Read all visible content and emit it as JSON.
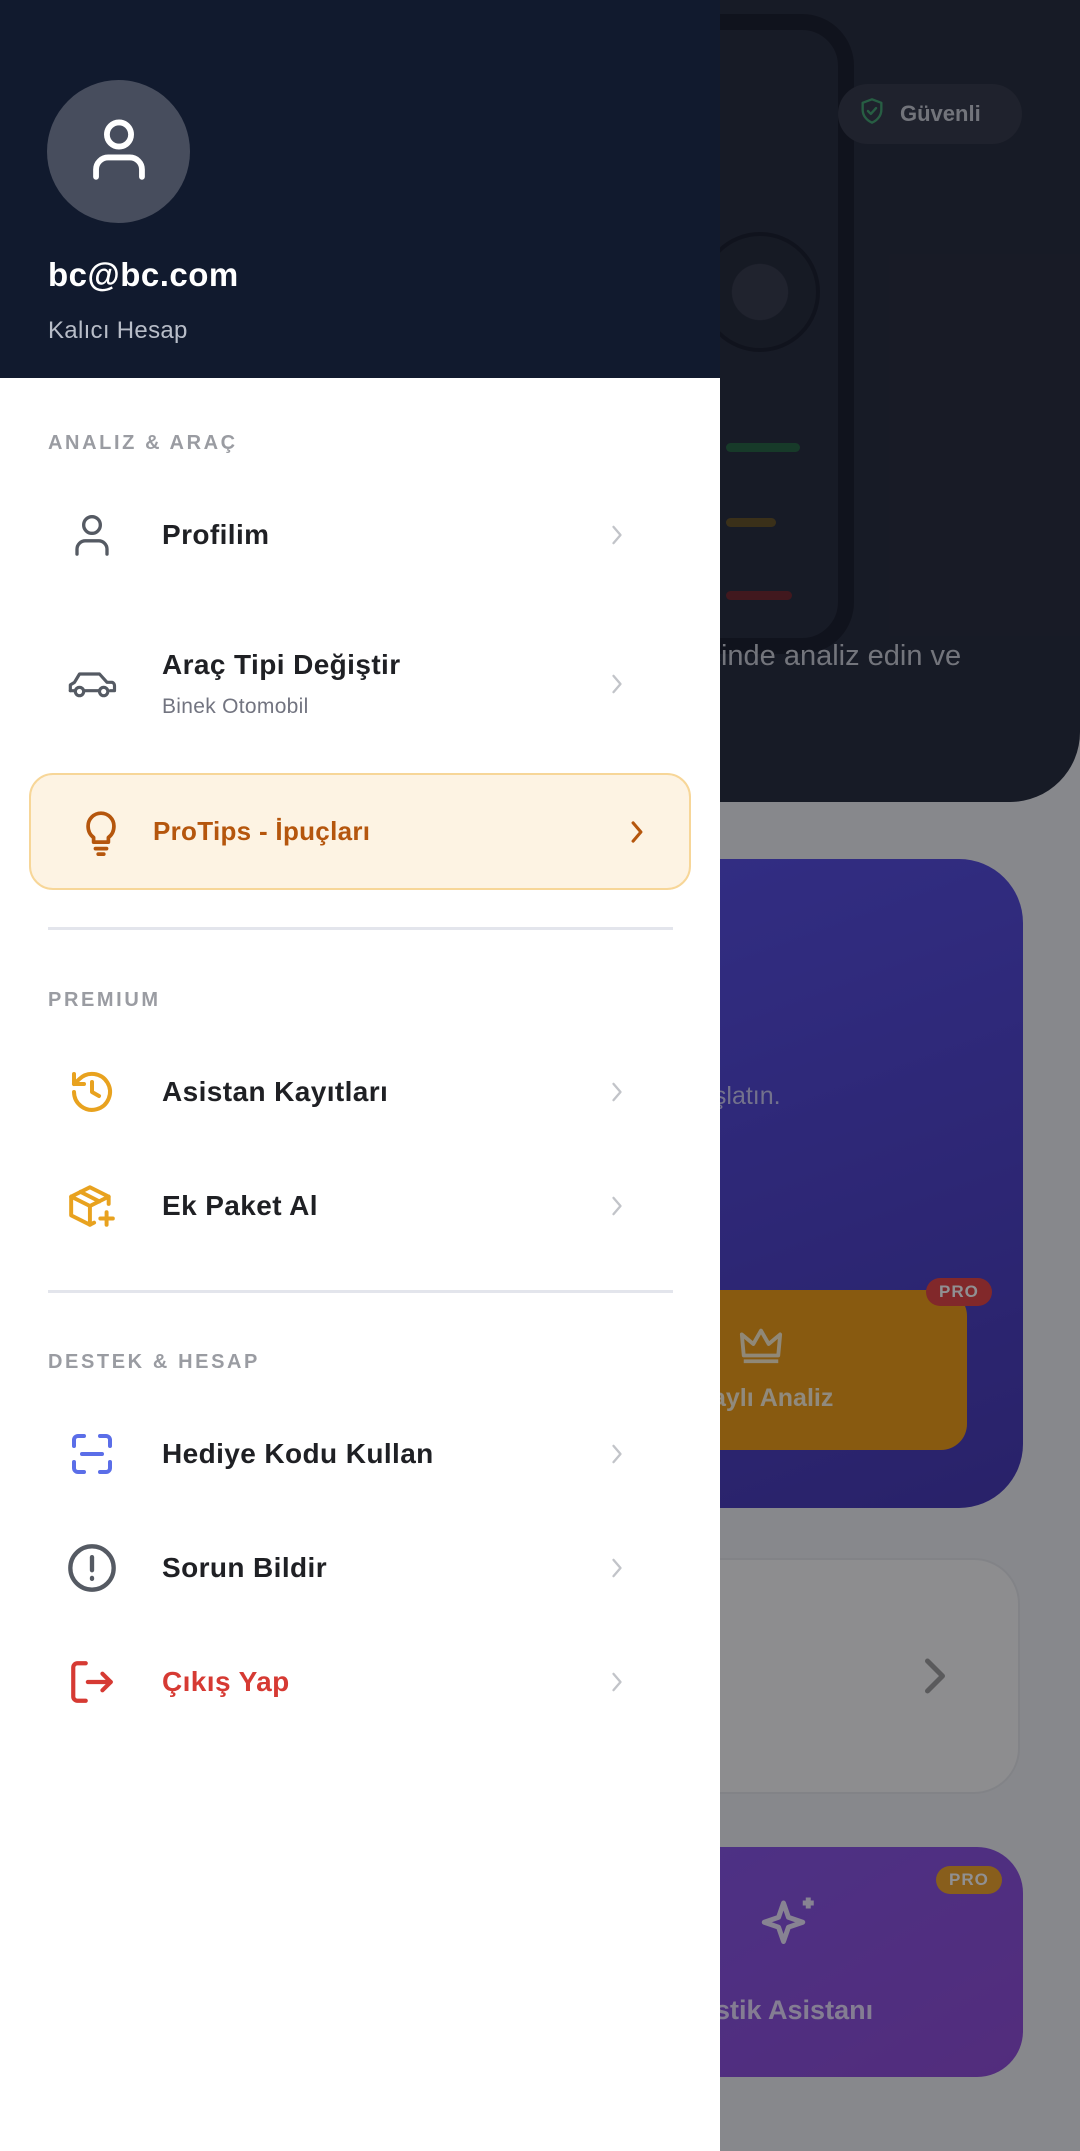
{
  "background_screen": {
    "badge_label": "Güvenli",
    "hero_text": "içinde analiz edin ve",
    "card_text": "aşlatın.",
    "orange_button_label": "aylı Analiz",
    "pro_badge": "PRO",
    "assistant_label": "astik Asistanı"
  },
  "drawer": {
    "user": {
      "email": "bc@bc.com",
      "account_type": "Kalıcı Hesap"
    },
    "sections": {
      "analysis": {
        "title": "ANALIZ & ARAÇ",
        "items": [
          {
            "label": "Profilim",
            "icon": "person-icon"
          },
          {
            "label": "Araç Tipi Değiştir",
            "sublabel": "Binek Otomobil",
            "icon": "car-icon"
          }
        ],
        "protips": {
          "label": "ProTips - İpuçları",
          "icon": "lightbulb-icon"
        }
      },
      "premium": {
        "title": "PREMIUM",
        "items": [
          {
            "label": "Asistan Kayıtları",
            "icon": "history-icon"
          },
          {
            "label": "Ek Paket Al",
            "icon": "package-plus-icon"
          }
        ]
      },
      "support": {
        "title": "DESTEK & HESAP",
        "items": [
          {
            "label": "Hediye Kodu Kullan",
            "icon": "scan-code-icon"
          },
          {
            "label": "Sorun Bildir",
            "icon": "alert-circle-icon"
          },
          {
            "label": "Çıkış Yap",
            "icon": "logout-icon"
          }
        ]
      }
    }
  },
  "colors": {
    "drawer_header_bg": "#111a2e",
    "accent_orange": "#e8a21f",
    "protips_text": "#b5560d",
    "danger": "#d63a33",
    "gift_blue": "#5b6ee8"
  }
}
